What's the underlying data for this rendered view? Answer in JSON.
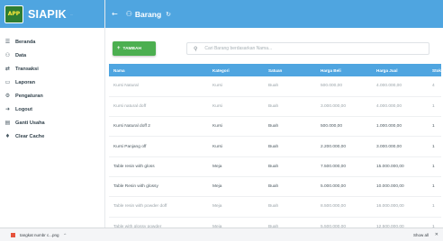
{
  "app": {
    "logo_text": "APP",
    "name": "SIAPIK",
    "subtitle": "...",
    "brand_color": "#4fa5e0"
  },
  "sidebar": {
    "items": [
      {
        "label": "Beranda",
        "icon": "ledger-icon"
      },
      {
        "label": "Data",
        "icon": "users-icon"
      },
      {
        "label": "Transaksi",
        "icon": "transfer-icon"
      },
      {
        "label": "Laporan",
        "icon": "report-icon"
      },
      {
        "label": "Pengaturan",
        "icon": "settings-icon"
      },
      {
        "label": "Logout",
        "icon": "logout-icon"
      },
      {
        "label": "Ganti Usaha",
        "icon": "switch-icon"
      },
      {
        "label": "Clear Cache",
        "icon": "clear-icon"
      }
    ]
  },
  "topbar": {
    "title": "Barang"
  },
  "toolbar": {
    "add_label": "TAMBAH",
    "add_color": "#4caf50",
    "search_placeholder": "Cari Barang berdasarkan Nama..."
  },
  "table": {
    "headers": [
      "Nama",
      "Kategori",
      "Satuan",
      "Harga Beli",
      "Harga Jual",
      "Stok"
    ],
    "rows": [
      [
        "Kursi Natural",
        "Kursi",
        "Buah",
        "500.000,00",
        "4.000.000,00",
        "4"
      ],
      [
        "Kursi natural doff",
        "Kursi",
        "Buah",
        "3.000.000,00",
        "4.000.000,00",
        "1"
      ],
      [
        "Kursi Natural doff 2",
        "Kursi",
        "Buah",
        "500.000,00",
        "1.000.000,00",
        "1"
      ],
      [
        "Kursi Panjang off",
        "Kursi",
        "Buah",
        "2.200.000,00",
        "3.000.000,00",
        "1"
      ],
      [
        "Table resin with gloss",
        "Meja",
        "Buah",
        "7.500.000,00",
        "15.000.000,00",
        "1"
      ],
      [
        "Table Resin with glossy",
        "Meja",
        "Buah",
        "5.000.000,00",
        "10.000.000,00",
        "1"
      ],
      [
        "Table resin with powder doff",
        "Meja",
        "Buah",
        "8.500.000,00",
        "16.000.000,00",
        "1"
      ],
      [
        "Table with glossy powder",
        "Meja",
        "Buah",
        "5.500.000,00",
        "12.500.000,00",
        "1"
      ]
    ]
  },
  "download_bar": {
    "file_name": "tangkat numbr c...png",
    "show_all": "Show all"
  }
}
